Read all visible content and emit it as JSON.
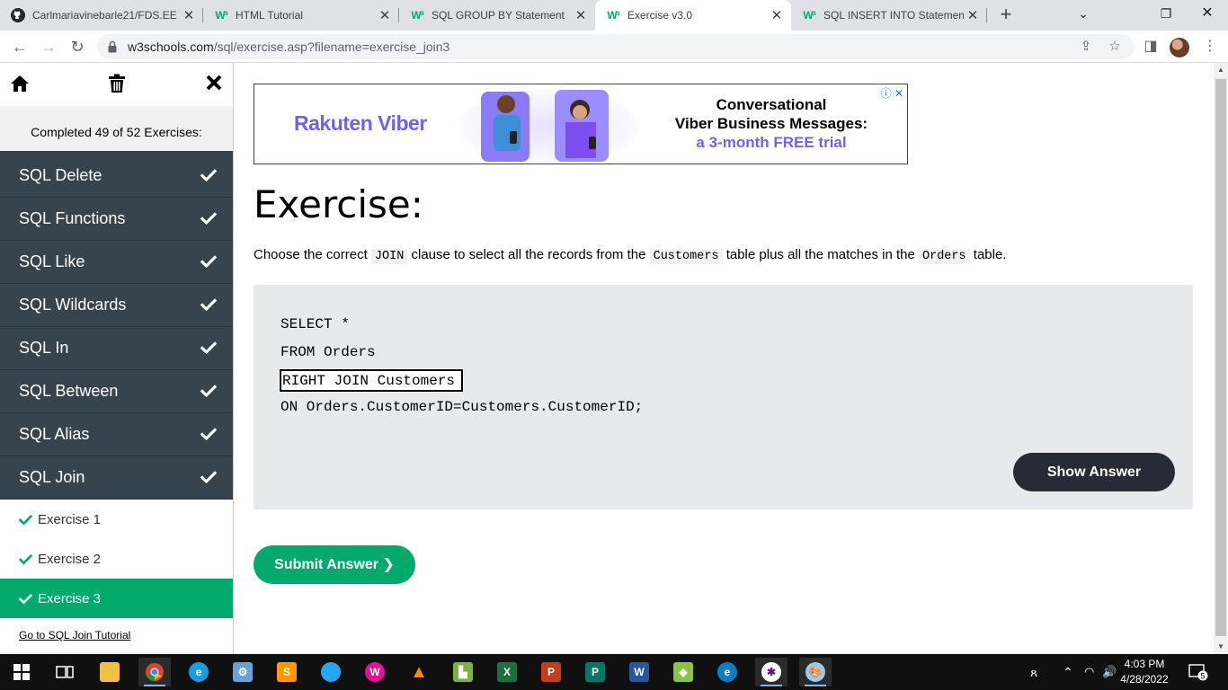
{
  "browser": {
    "tabs": [
      {
        "title": "Carlmariavinebarle21/FDS.EE",
        "favicon": "github-icon"
      },
      {
        "title": "HTML Tutorial",
        "favicon": "w3schools-icon"
      },
      {
        "title": "SQL GROUP BY Statement",
        "favicon": "w3schools-icon"
      },
      {
        "title": "Exercise v3.0",
        "favicon": "w3schools-icon",
        "active": true
      },
      {
        "title": "SQL INSERT INTO Statement",
        "favicon": "w3schools-icon"
      }
    ],
    "url_host": "w3schools.com",
    "url_path": "/sql/exercise.asp?filename=exercise_join3"
  },
  "sidebar": {
    "progress": "Completed 49 of 52 Exercises:",
    "topics": [
      {
        "label": "SQL Delete",
        "done": true
      },
      {
        "label": "SQL Functions",
        "done": true
      },
      {
        "label": "SQL Like",
        "done": true
      },
      {
        "label": "SQL Wildcards",
        "done": true
      },
      {
        "label": "SQL In",
        "done": true
      },
      {
        "label": "SQL Between",
        "done": true
      },
      {
        "label": "SQL Alias",
        "done": true
      },
      {
        "label": "SQL Join",
        "done": true
      }
    ],
    "exercises": [
      {
        "label": "Exercise 1",
        "done": true
      },
      {
        "label": "Exercise 2",
        "done": true
      },
      {
        "label": "Exercise 3",
        "done": true,
        "active": true
      }
    ],
    "tutorial_link": "Go to SQL Join Tutorial"
  },
  "ad": {
    "brand": "Rakuten Viber",
    "line1": "Conversational",
    "line2": "Viber Business Messages:",
    "line3": "a 3-month FREE trial",
    "accent": "#7360f2"
  },
  "exercise": {
    "heading": "Exercise:",
    "instr_1": "Choose the correct ",
    "code_1": "JOIN",
    "instr_2": " clause to select all the records from the ",
    "code_2": "Customers",
    "instr_3": " table plus all the matches in the ",
    "code_3": "Orders",
    "instr_4": " table.",
    "line1": "SELECT *",
    "line2": "FROM Orders",
    "input_value": "RIGHT JOIN Customers",
    "line4": "ON Orders.CustomerID=Customers.CustomerID;",
    "show_answer": "Show Answer",
    "submit": "Submit Answer ❯",
    "brand_green": "#04aa6d"
  },
  "taskbar": {
    "time": "4:03 PM",
    "date": "4/28/2022",
    "notifications": "5"
  }
}
